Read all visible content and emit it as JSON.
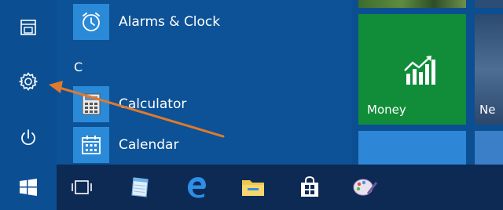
{
  "colors": {
    "background": "#0b4f92",
    "app_tile": "#2b8ad8",
    "money_tile": "#118d3a",
    "taskbar": "#0d2a55",
    "arrow": "#e07a2c"
  },
  "rail": {
    "items": [
      {
        "icon": "file-explorer-icon"
      },
      {
        "icon": "settings-gear-icon"
      },
      {
        "icon": "power-icon"
      }
    ]
  },
  "app_list": {
    "items": [
      {
        "label": "Alarms & Clock",
        "icon": "alarm-clock-icon"
      },
      {
        "label": "Calculator",
        "icon": "calculator-icon"
      },
      {
        "label": "Calendar",
        "icon": "calendar-icon"
      }
    ],
    "section_header": "C"
  },
  "tiles": {
    "money": {
      "label": "Money",
      "icon": "money-chart-icon"
    },
    "news": {
      "label": "Ne"
    }
  },
  "taskbar": {
    "items": [
      {
        "icon": "windows-start-icon"
      },
      {
        "icon": "task-view-icon"
      },
      {
        "icon": "notepad-icon"
      },
      {
        "icon": "edge-browser-icon"
      },
      {
        "icon": "file-explorer-folder-icon"
      },
      {
        "icon": "store-icon"
      },
      {
        "icon": "paint-icon"
      }
    ]
  }
}
